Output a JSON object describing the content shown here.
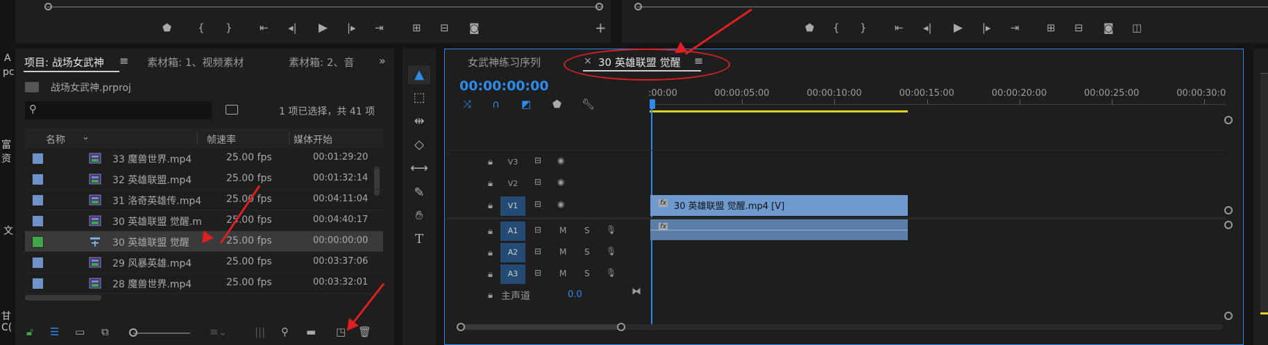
{
  "source_monitor": {
    "transport": [
      "marker",
      "mark-in",
      "mark-out",
      "go-to-in",
      "step-back",
      "play",
      "step-forward",
      "go-to-out",
      "insert",
      "overwrite",
      "export-frame",
      "add"
    ]
  },
  "program_monitor": {
    "transport": [
      "marker",
      "mark-in",
      "mark-out",
      "go-to-in",
      "step-back",
      "play",
      "step-forward",
      "go-to-out",
      "lift",
      "extract",
      "export-frame",
      "compare"
    ]
  },
  "project_panel": {
    "tabs": [
      {
        "label": "项目: 战场女武神",
        "active": true
      },
      {
        "label": "素材箱: 1、视频素材",
        "active": false
      },
      {
        "label": "素材箱: 2、音",
        "active": false
      }
    ],
    "project_file": "战场女武神.prproj",
    "selection_info": "1 项已选择，共 41 项",
    "columns": {
      "name": "名称",
      "fps": "帧速率",
      "start": "媒体开始"
    },
    "items": [
      {
        "name": "33 魔兽世界.mp4",
        "fps": "25.00 fps",
        "start": "00:01:29:20",
        "color": "#6e93c9",
        "type": "video",
        "selected": false
      },
      {
        "name": "32 英雄联盟.mp4",
        "fps": "25.00 fps",
        "start": "00:01:32:14",
        "color": "#6e93c9",
        "type": "video",
        "selected": false
      },
      {
        "name": "31 洛奇英雄传.mp4",
        "fps": "25.00 fps",
        "start": "00:04:11:04",
        "color": "#6e93c9",
        "type": "video",
        "selected": false
      },
      {
        "name": "30 英雄联盟 觉醒.m",
        "fps": "25.00 fps",
        "start": "00:04:40:17",
        "color": "#6e93c9",
        "type": "video",
        "selected": false
      },
      {
        "name": "30 英雄联盟 觉醒",
        "fps": "25.00 fps",
        "start": "00:00:00:00",
        "color": "#3fa64a",
        "type": "sequence",
        "selected": true
      },
      {
        "name": "29 风暴英雄.mp4",
        "fps": "25.00 fps",
        "start": "00:03:37:06",
        "color": "#6e93c9",
        "type": "video",
        "selected": false
      },
      {
        "name": "28 魔兽世界.mp4",
        "fps": "25.00 fps",
        "start": "00:03:32:01",
        "color": "#6e93c9",
        "type": "video",
        "selected": false
      }
    ]
  },
  "timeline": {
    "tabs": [
      {
        "label": "女武神练习序列",
        "active": false
      },
      {
        "label": "30 英雄联盟 觉醒",
        "active": true,
        "close": "×"
      }
    ],
    "timecode": "00:00:00:00",
    "ruler_labels": [
      ":00:00",
      "00:00:05:00",
      "00:00:10:00",
      "00:00:15:00",
      "00:00:20:00",
      "00:00:25:00",
      "00:00:30:0"
    ],
    "video_tracks": [
      "V3",
      "V2",
      "V1"
    ],
    "audio_tracks": [
      "A1",
      "A2",
      "A3"
    ],
    "audio_m": "M",
    "audio_s": "S",
    "master": {
      "label": "主声道",
      "value": "0.0"
    },
    "clip_video_label": "30 英雄联盟 觉醒.mp4 [V]",
    "fx": "fx",
    "colors": {
      "accent": "#2d8ceb",
      "clip_video": "#6f9ad0",
      "clip_audio": "#5a7ea8",
      "work_area": "#e5d221",
      "annotation": "#e02020"
    }
  },
  "edge_fragments": [
    "A",
    "pc",
    "富",
    "资",
    "文",
    "甘",
    "C("
  ]
}
